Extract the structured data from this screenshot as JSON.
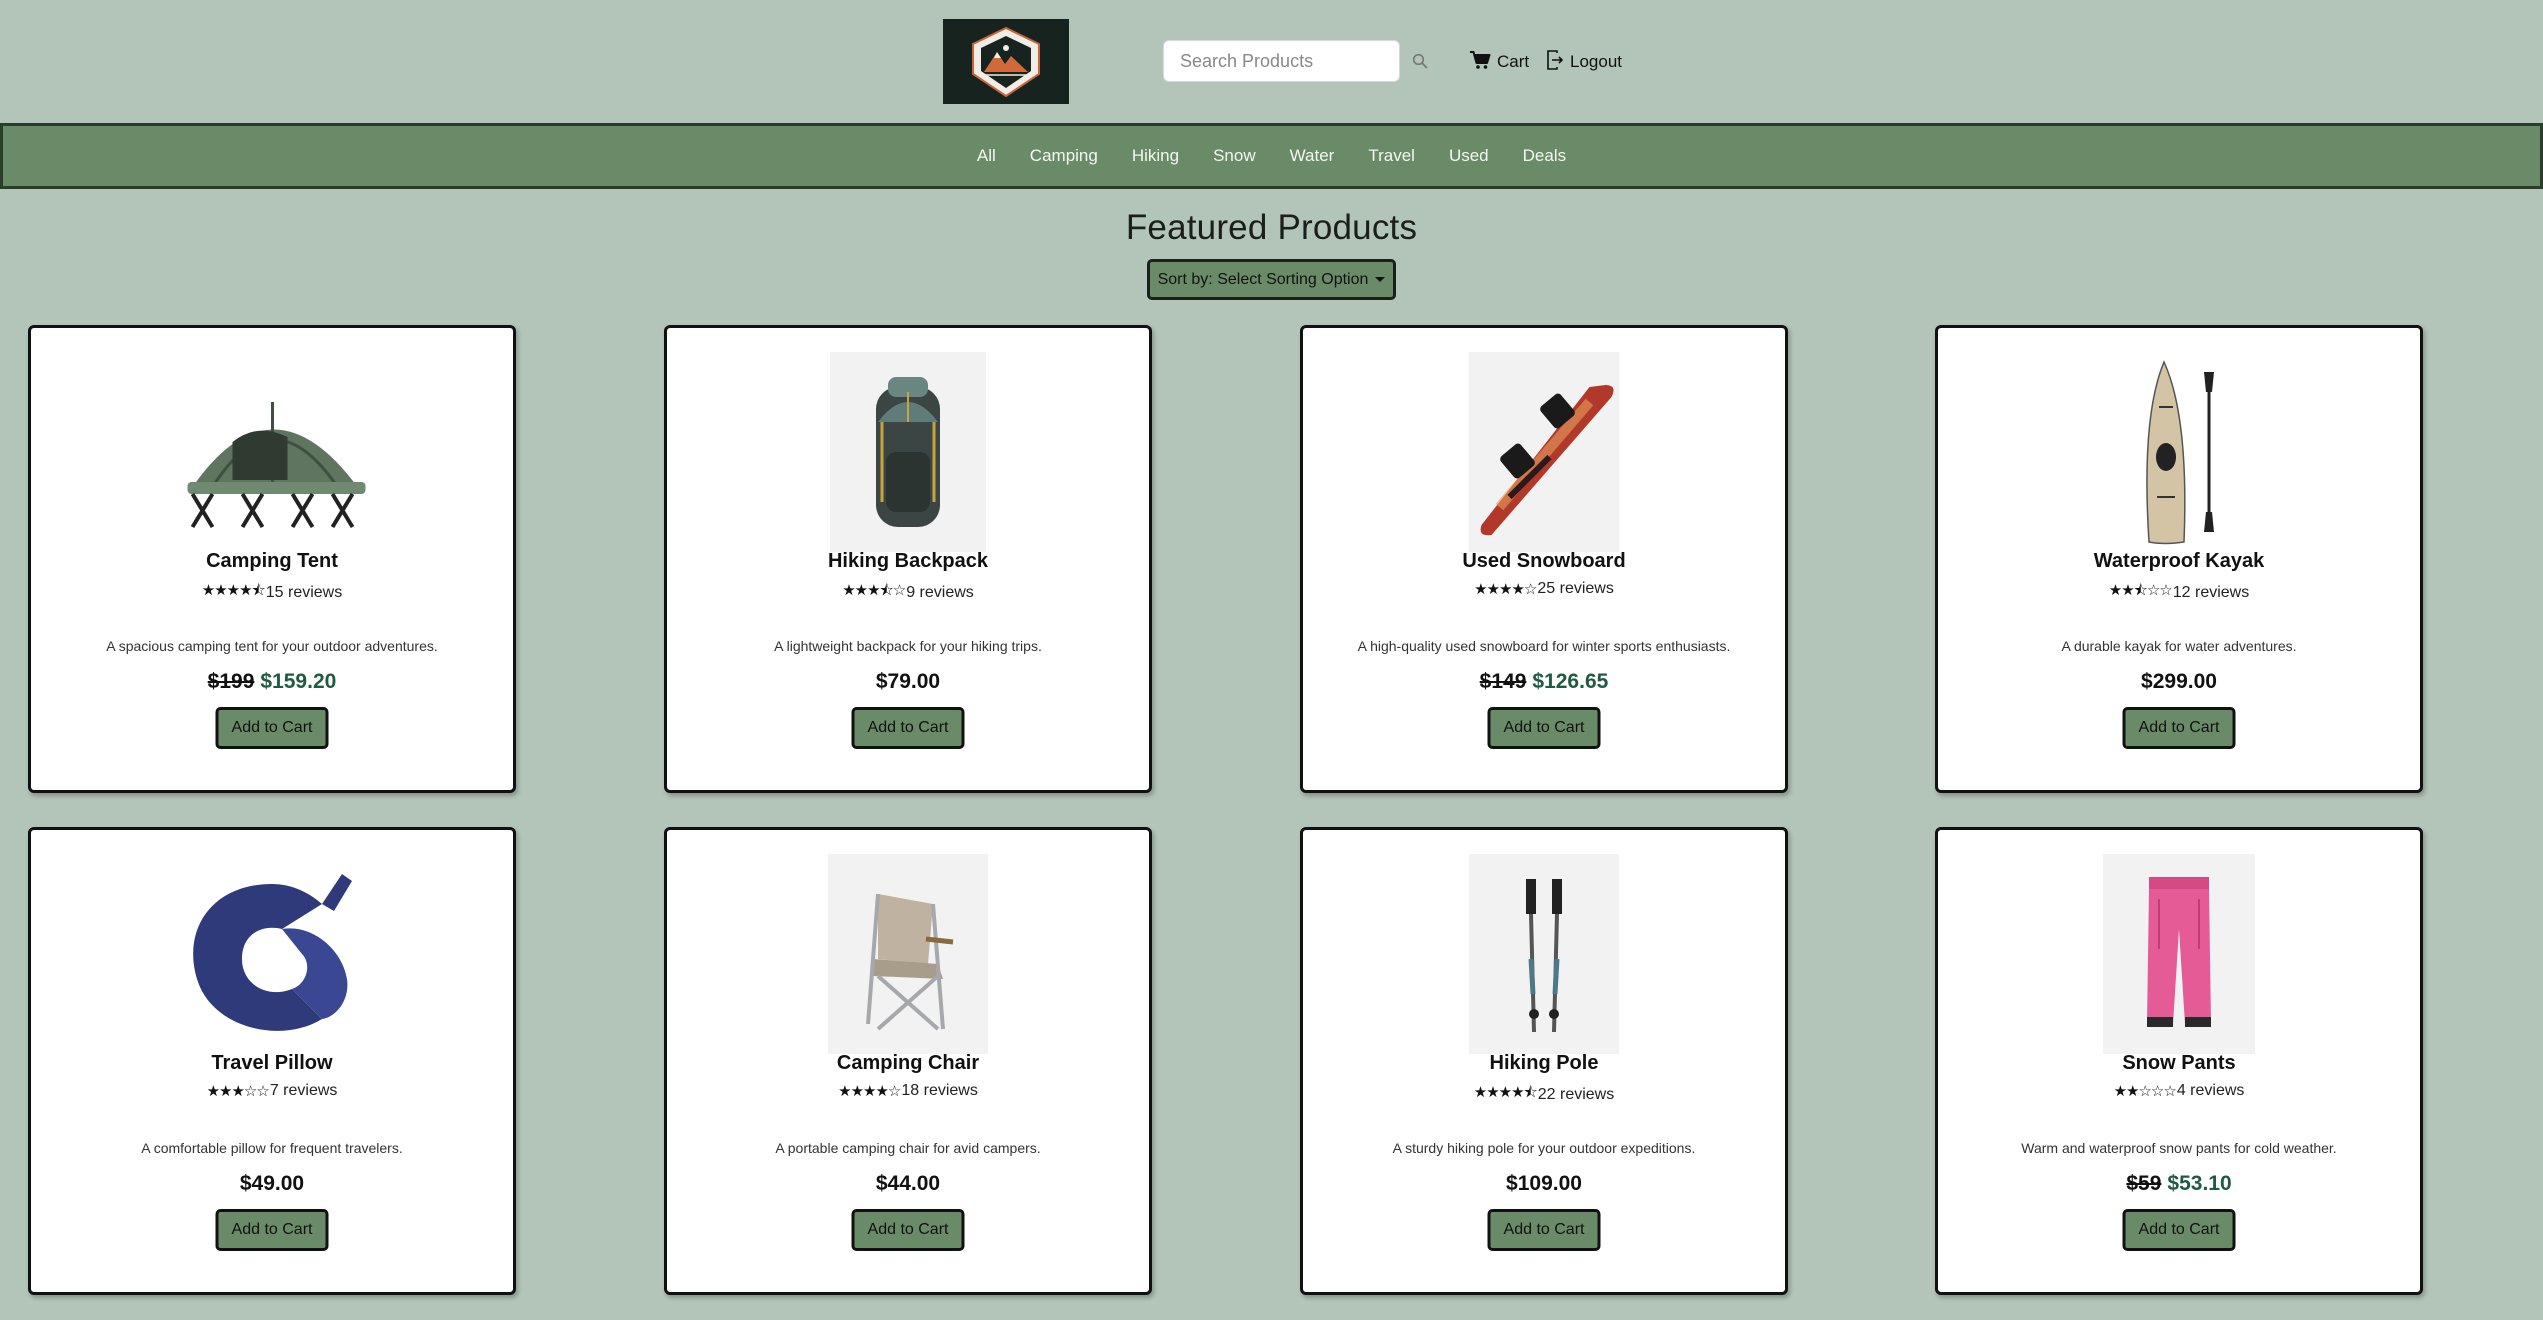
{
  "header": {
    "search_placeholder": "Search Products",
    "cart_label": "Cart",
    "logout_label": "Logout"
  },
  "nav": {
    "items": [
      "All",
      "Camping",
      "Hiking",
      "Snow",
      "Water",
      "Travel",
      "Used",
      "Deals"
    ]
  },
  "main": {
    "title": "Featured Products",
    "sort_label": "Sort by: Select Sorting Option"
  },
  "products": [
    {
      "name": "Camping Tent",
      "stars": "★★★★⯪",
      "rating": 4.5,
      "reviews": "15 reviews",
      "description": "A spacious camping tent for your outdoor adventures.",
      "old_price": "$199",
      "price": "$159.20",
      "on_sale": true,
      "button": "Add to Cart",
      "icon": "tent-icon"
    },
    {
      "name": "Hiking Backpack",
      "stars": "★★★⯪☆",
      "rating": 3.5,
      "reviews": "9 reviews",
      "description": "A lightweight backpack for your hiking trips.",
      "old_price": "",
      "price": "$79.00",
      "on_sale": false,
      "button": "Add to Cart",
      "icon": "backpack-icon"
    },
    {
      "name": "Used Snowboard",
      "stars": "★★★★☆",
      "rating": 4,
      "reviews": "25 reviews",
      "description": "A high-quality used snowboard for winter sports enthusiasts.",
      "old_price": "$149",
      "price": "$126.65",
      "on_sale": true,
      "button": "Add to Cart",
      "icon": "snowboard-icon"
    },
    {
      "name": "Waterproof Kayak",
      "stars": "★★⯪☆☆",
      "rating": 2.5,
      "reviews": "12 reviews",
      "description": "A durable kayak for water adventures.",
      "old_price": "",
      "price": "$299.00",
      "on_sale": false,
      "button": "Add to Cart",
      "icon": "kayak-icon"
    },
    {
      "name": "Travel Pillow",
      "stars": "★★★☆☆",
      "rating": 3,
      "reviews": "7 reviews",
      "description": "A comfortable pillow for frequent travelers.",
      "old_price": "",
      "price": "$49.00",
      "on_sale": false,
      "button": "Add to Cart",
      "icon": "pillow-icon"
    },
    {
      "name": "Camping Chair",
      "stars": "★★★★☆",
      "rating": 4,
      "reviews": "18 reviews",
      "description": "A portable camping chair for avid campers.",
      "old_price": "",
      "price": "$44.00",
      "on_sale": false,
      "button": "Add to Cart",
      "icon": "chair-icon"
    },
    {
      "name": "Hiking Pole",
      "stars": "★★★★⯪",
      "rating": 4.5,
      "reviews": "22 reviews",
      "description": "A sturdy hiking pole for your outdoor expeditions.",
      "old_price": "",
      "price": "$109.00",
      "on_sale": false,
      "button": "Add to Cart",
      "icon": "hiking-pole-icon"
    },
    {
      "name": "Snow Pants",
      "stars": "★★☆☆☆",
      "rating": 2,
      "reviews": "4 reviews",
      "description": "Warm and waterproof snow pants for cold weather.",
      "old_price": "$59",
      "price": "$53.10",
      "on_sale": true,
      "button": "Add to Cart",
      "icon": "snow-pants-icon"
    }
  ],
  "colors": {
    "background": "#b2c5b8",
    "nav": "#6a8b67",
    "button": "#6a8b67",
    "sale_price": "#1f5a44",
    "logo_bg": "#16231f"
  }
}
